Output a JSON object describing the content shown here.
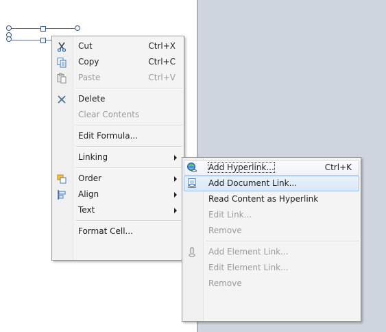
{
  "context_menu": {
    "items": [
      {
        "label": "Cut",
        "shortcut": "Ctrl+X",
        "icon": "scissors-icon"
      },
      {
        "label": "Copy",
        "shortcut": "Ctrl+C",
        "icon": "copy-icon"
      },
      {
        "label": "Paste",
        "shortcut": "Ctrl+V",
        "icon": "paste-icon"
      },
      {
        "label": "Delete",
        "icon": "delete-x-icon"
      },
      {
        "label": "Clear Contents"
      },
      {
        "label": "Edit Formula..."
      },
      {
        "label": "Linking"
      },
      {
        "label": "Order",
        "icon": "order-icon"
      },
      {
        "label": "Align",
        "icon": "align-icon"
      },
      {
        "label": "Text"
      },
      {
        "label": "Format Cell..."
      }
    ]
  },
  "submenu": {
    "items": [
      {
        "label": "Add Hyperlink...",
        "shortcut": "Ctrl+K",
        "icon": "globe-link-icon"
      },
      {
        "label": "Add Document Link...",
        "icon": "document-link-icon"
      },
      {
        "label": "Read Content as Hyperlink"
      },
      {
        "label": "Edit Link..."
      },
      {
        "label": "Remove"
      },
      {
        "label": "Add Element Link...",
        "icon": "element-link-icon"
      },
      {
        "label": "Edit Element Link..."
      },
      {
        "label": "Remove"
      }
    ]
  },
  "colors": {
    "accent": "#9ebfe4",
    "panel": "#cfd5dd",
    "disabled": "#9a9a9a"
  }
}
